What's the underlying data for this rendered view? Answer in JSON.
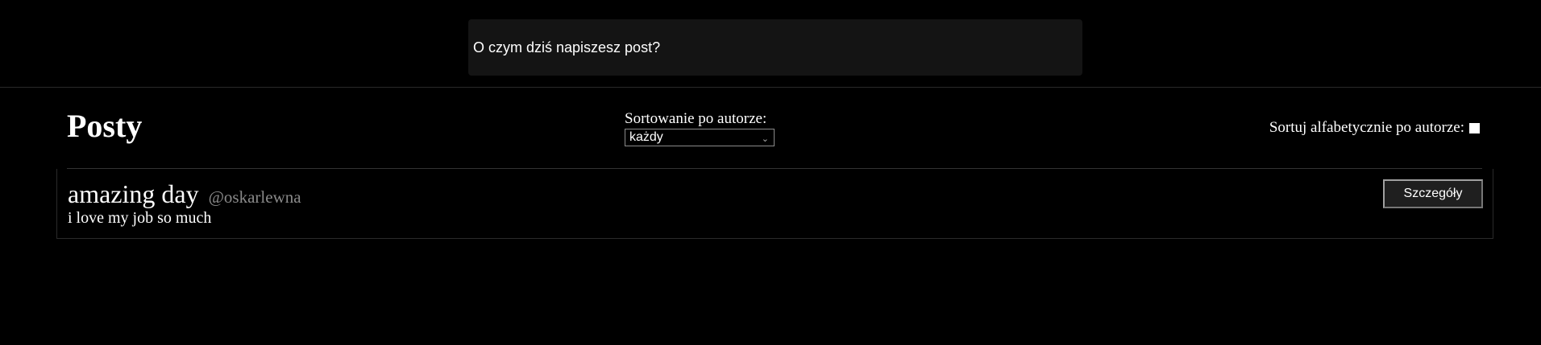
{
  "composer": {
    "placeholder": "O czym dziś napiszesz post?"
  },
  "header": {
    "title": "Posty",
    "sort_author_label": "Sortowanie po autorze:",
    "sort_author_selected": "każdy",
    "sort_alpha_label": "Sortuj alfabetycznie po autorze:",
    "sort_alpha_checked": false
  },
  "posts": [
    {
      "title": "amazing day",
      "author": "@oskarlewna",
      "body": "i love my job so much",
      "details_label": "Szczegóły"
    }
  ],
  "icons": {
    "select_chevron": "chevron-down-icon"
  }
}
